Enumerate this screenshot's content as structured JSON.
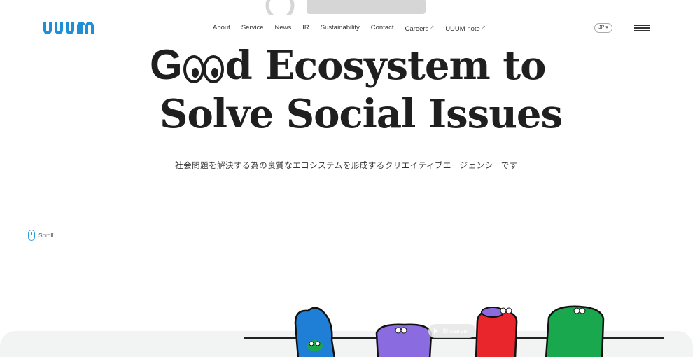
{
  "header": {
    "logo": "UUUM",
    "nav": [
      {
        "label": "About",
        "external": false
      },
      {
        "label": "Service",
        "external": false
      },
      {
        "label": "News",
        "external": false
      },
      {
        "label": "IR",
        "external": false
      },
      {
        "label": "Sustainability",
        "external": false
      },
      {
        "label": "Contact",
        "external": false
      },
      {
        "label": "Careers",
        "external": true
      },
      {
        "label": "UUUM note",
        "external": true
      }
    ],
    "external_mark": "↗",
    "lang": "JP ▾",
    "menu_icon": "hamburger-icon"
  },
  "hero": {
    "line1_start": "G",
    "line1_end": "d Ecosystem to",
    "line2": "Solve Social Issues",
    "subtitle": "社会問題を解決する為の良質なエコシステムを形成するクリエイティブエージェンシーです"
  },
  "scroll": {
    "label": "Scroll",
    "icon": "mouse-icon"
  },
  "showreel": {
    "label": "Showreel",
    "icon": "play-icon"
  },
  "colors": {
    "brand": "#1e8fd6",
    "accent_scroll": "#2ea0d8",
    "char_blue": "#1f7fd6",
    "char_purple": "#8a6be0",
    "char_red": "#e8262b",
    "char_green": "#1aa84f"
  }
}
